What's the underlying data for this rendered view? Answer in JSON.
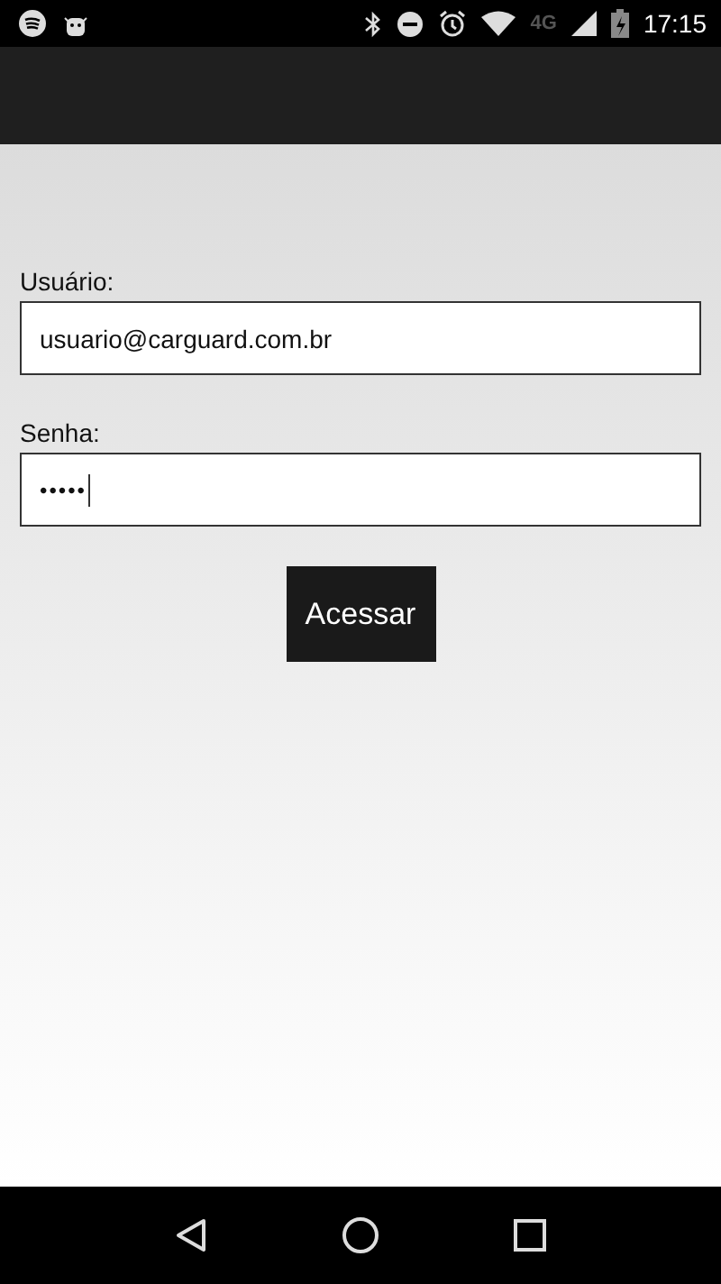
{
  "status_bar": {
    "network": "4G",
    "time": "17:15"
  },
  "form": {
    "username_label": "Usuário:",
    "username_value": "usuario@carguard.com.br",
    "password_label": "Senha:",
    "password_dots": "•••••",
    "password_focused": true
  },
  "buttons": [
    "Acessar"
  ]
}
